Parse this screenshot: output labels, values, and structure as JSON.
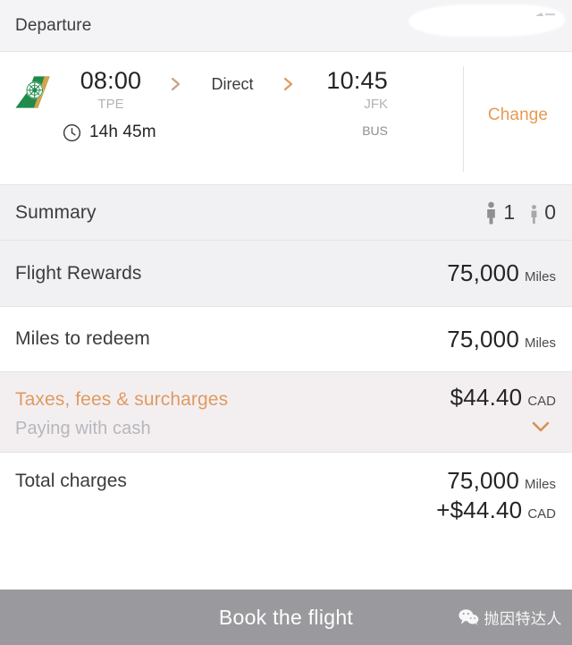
{
  "header": {
    "title": "Departure",
    "redacted_note": "redacted-area"
  },
  "flight": {
    "airline_logo": "eva-air-tailfin-logo",
    "departure_time": "08:00",
    "departure_airport": "TPE",
    "stops": "Direct",
    "arrival_time": "10:45",
    "arrival_airport": "JFK",
    "arrival_terminal": "BUS",
    "duration": "14h 45m",
    "duration_icon": "clock-icon",
    "arrow_icon": "chevron-right-icon",
    "change_label": "Change"
  },
  "summary": {
    "label": "Summary",
    "adult_icon": "adult-passenger-icon",
    "adult_count": "1",
    "child_icon": "child-passenger-icon",
    "child_count": "0"
  },
  "rows": {
    "flight_rewards": {
      "label": "Flight Rewards",
      "amount": "75,000",
      "unit": "Miles"
    },
    "miles_to_redeem": {
      "label": "Miles to redeem",
      "amount": "75,000",
      "unit": "Miles"
    },
    "taxes": {
      "label": "Taxes, fees & surcharges",
      "amount": "$44.40",
      "unit": "CAD",
      "sublabel": "Paying with cash",
      "expand_icon": "chevron-down-icon"
    },
    "total": {
      "label": "Total charges",
      "miles_amount": "75,000",
      "miles_unit": "Miles",
      "cash_amount": "+$44.40",
      "cash_unit": "CAD"
    }
  },
  "footer": {
    "book_label": "Book the flight",
    "watermark_icon": "wechat-icon",
    "watermark_text": "抛因特达人"
  },
  "colors": {
    "accent_orange": "#e79a53",
    "taxes_label": "#e09a62",
    "text_primary": "#242426",
    "text_secondary": "#8e8e93",
    "row_grey": "#f1f1f4",
    "row_tint": "#f3eff1",
    "footer_grey": "#9a9a9e"
  }
}
